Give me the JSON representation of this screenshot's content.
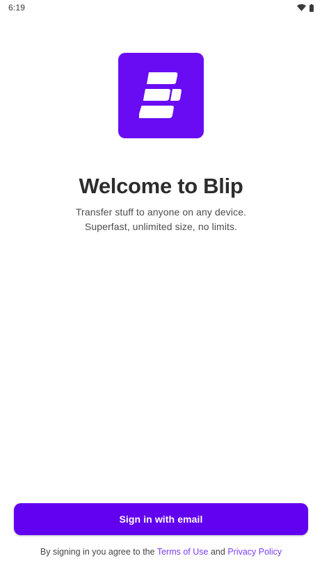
{
  "status_bar": {
    "time": "6:19",
    "icons": [
      "wifi-icon",
      "battery-icon"
    ]
  },
  "logo": {
    "icon": "blip-logo-icon",
    "background_color": "#6a0cf3"
  },
  "welcome": {
    "title": "Welcome to Blip",
    "tagline_line1": "Transfer stuff to anyone on any device.",
    "tagline_line2": "Superfast, unlimited size, no limits."
  },
  "sign_in": {
    "label": "Sign in with email",
    "color": "#6200f0"
  },
  "legal": {
    "prefix": "By signing in you agree to the",
    "terms_link": "Terms of Use",
    "conjunction": "and",
    "privacy_link": "Privacy Policy",
    "link_color": "#7b3cf5"
  }
}
